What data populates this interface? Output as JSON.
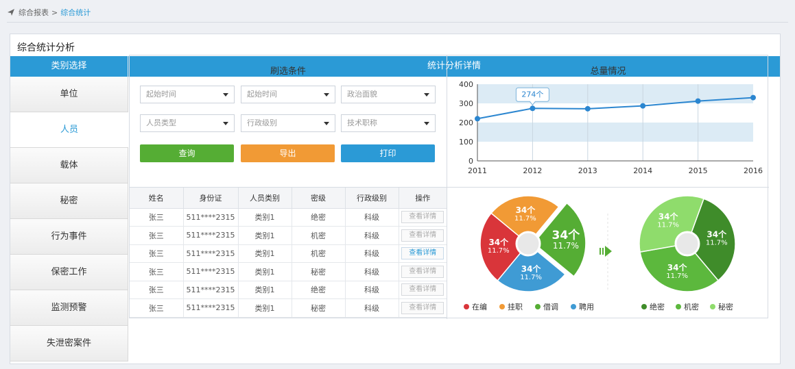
{
  "breadcrumb": {
    "parent": "综合报表",
    "separator": ">",
    "current": "综合统计"
  },
  "panel": {
    "title": "综合统计分析"
  },
  "header": {
    "left": "类别选择",
    "right": "统计分析详情"
  },
  "sidebar": {
    "items": [
      {
        "label": "单位",
        "active": false
      },
      {
        "label": "人员",
        "active": true
      },
      {
        "label": "载体",
        "active": false
      },
      {
        "label": "秘密",
        "active": false
      },
      {
        "label": "行为事件",
        "active": false
      },
      {
        "label": "保密工作",
        "active": false
      },
      {
        "label": "监测预警",
        "active": false
      },
      {
        "label": "失泄密案件",
        "active": false
      }
    ]
  },
  "filters": {
    "title": "刷选条件",
    "selects": [
      "起始时间",
      "起始时间",
      "政治面貌",
      "人员类型",
      "行政级别",
      "技术职称"
    ],
    "buttons": {
      "query": "查询",
      "export": "导出",
      "print": "打印"
    }
  },
  "table": {
    "headers": [
      "姓名",
      "身份证",
      "人员类别",
      "密级",
      "行政级别",
      "操作"
    ],
    "rows": [
      [
        "张三",
        "511****2315",
        "类别1",
        "绝密",
        "科级",
        "查看详情"
      ],
      [
        "张三",
        "511****2315",
        "类别1",
        "机密",
        "科级",
        "查看详情"
      ],
      [
        "张三",
        "511****2315",
        "类别1",
        "机密",
        "科级",
        "查看详情"
      ],
      [
        "张三",
        "511****2315",
        "类别1",
        "秘密",
        "科级",
        "查看详情"
      ],
      [
        "张三",
        "511****2315",
        "类别1",
        "绝密",
        "科级",
        "查看详情"
      ],
      [
        "张三",
        "511****2315",
        "类别1",
        "秘密",
        "科级",
        "查看详情"
      ]
    ]
  },
  "colors": {
    "accent": "#2b9ad6",
    "green": "#55ad34",
    "orange": "#f19a35",
    "red": "#d9353a",
    "blue": "#3f9bd4"
  },
  "chart_data": [
    {
      "type": "line",
      "title": "总量情况",
      "x": [
        "2011",
        "2012",
        "2013",
        "2014",
        "2015",
        "2016"
      ],
      "series": [
        {
          "values": [
            220,
            274,
            272,
            287,
            312,
            330
          ]
        }
      ],
      "ylim": [
        0,
        400
      ],
      "yticks": [
        0,
        100,
        200,
        300,
        400
      ],
      "annotation": {
        "x": "2012",
        "text": "274个"
      },
      "grid": "alternating horizontal bands"
    },
    {
      "type": "pie",
      "slices": [
        {
          "name": "在编",
          "value": 34,
          "label": "34个",
          "percent": "11.7%",
          "color": "#d9353a"
        },
        {
          "name": "挂职",
          "value": 34,
          "label": "34个",
          "percent": "11.7%",
          "color": "#f19a35"
        },
        {
          "name": "借调",
          "value": 34,
          "label": "34个",
          "percent": "11.7%",
          "color": "#55ad34"
        },
        {
          "name": "聘用",
          "value": 34,
          "label": "34个",
          "percent": "11.7%",
          "color": "#3f9bd4"
        }
      ],
      "legend": [
        "在编",
        "挂职",
        "借调",
        "聘用"
      ]
    },
    {
      "type": "pie",
      "slices": [
        {
          "name": "绝密",
          "value": 34,
          "label": "34个",
          "percent": "11.7%",
          "color": "#3f8c2a"
        },
        {
          "name": "机密",
          "value": 34,
          "label": "34个",
          "percent": "11.7%",
          "color": "#5cb83d"
        },
        {
          "name": "秘密",
          "value": 34,
          "label": "34个",
          "percent": "11.7%",
          "color": "#8fdc6c"
        }
      ],
      "legend": [
        "绝密",
        "机密",
        "秘密"
      ]
    }
  ]
}
